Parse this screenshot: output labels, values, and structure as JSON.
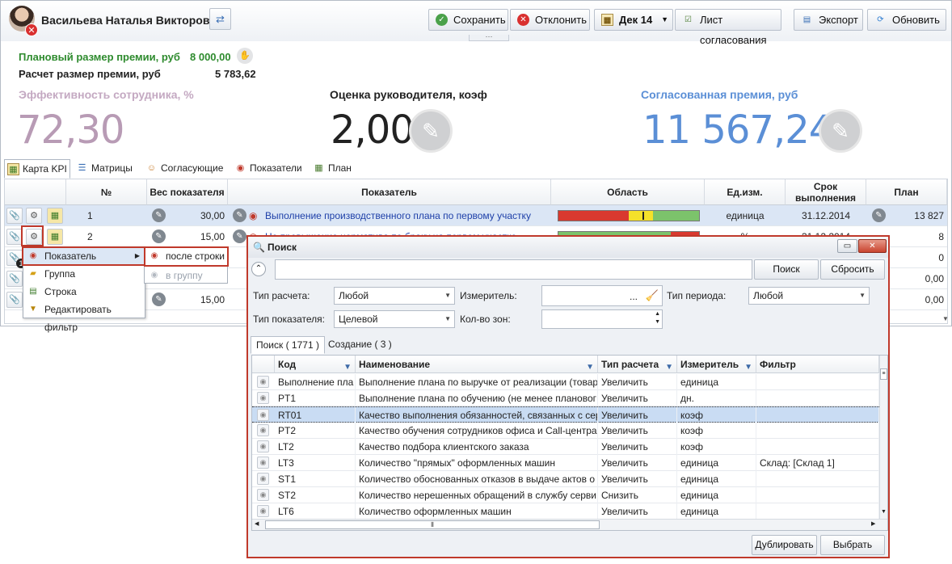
{
  "user": {
    "name": "Васильева Наталья Викторовна"
  },
  "toolbar": {
    "save": "Сохранить",
    "reject": "Отклонить",
    "period": "Дек 14",
    "approval_sheet": "Лист согласования",
    "export": "Экспорт",
    "refresh": "Обновить"
  },
  "summary": {
    "planned_label": "Плановый размер премии, руб",
    "planned_value": "8 000,00",
    "calc_label": "Расчет размер премии, руб",
    "calc_value": "5 783,62"
  },
  "metrics": [
    {
      "label": "Эффективность сотрудника, %",
      "value": "72,30",
      "color": "#b89bb5"
    },
    {
      "label": "Оценка руководителя, коэф",
      "value": "2,00",
      "color": "#222222"
    },
    {
      "label": "Согласованная премия, руб",
      "value": "11 567,24",
      "color": "#5b8fd6"
    }
  ],
  "tabs": [
    "Карта KPI",
    "Матрицы",
    "Согласующие",
    "Показатели",
    "План"
  ],
  "grid": {
    "headers": {
      "num": "№",
      "weight": "Вес показателя",
      "indicator": "Показатель",
      "area": "Область",
      "unit": "Ед.изм.",
      "deadline": "Срок выполнения",
      "plan": "План"
    },
    "rows": [
      {
        "num": "1",
        "weight": "30,00",
        "indicator": "Выполнение производственного плана по первому участку",
        "unit": "единица",
        "deadline": "31.12.2014",
        "plan": "13 827"
      },
      {
        "num": "2",
        "weight": "15,00",
        "indicator": "Не превышение норматива по браку на первом участке",
        "unit": "%",
        "deadline": "31.12.2014",
        "plan": "8"
      },
      {
        "plan": "0"
      },
      {
        "plan": "0,00"
      },
      {
        "weight": "15,00",
        "plan": "0,00"
      }
    ],
    "badge": "1"
  },
  "context_menu": {
    "items": [
      "Показатель",
      "Группа",
      "Строка",
      "Редактировать фильтр"
    ],
    "submenu": [
      "после строки",
      "в группу"
    ]
  },
  "dialog": {
    "title": "Поиск",
    "search_btn": "Поиск",
    "reset_btn": "Сбросить",
    "calc_type_label": "Тип расчета:",
    "calc_type_value": "Любой",
    "meter_label": "Измеритель:",
    "meter_value": "...",
    "period_type_label": "Тип периода:",
    "period_type_value": "Любой",
    "indicator_type_label": "Тип показателя:",
    "indicator_type_value": "Целевой",
    "zones_label": "Кол-во зон:",
    "tab_search": "Поиск ( 1771 )",
    "tab_create": "Создание ( 3 )",
    "columns": [
      "Код",
      "Наименование",
      "Тип расчета",
      "Измеритель",
      "Фильтр"
    ],
    "rows": [
      [
        "Выполнение пла",
        "Выполнение плана по выручке от реализации (товар",
        "Увеличить",
        "единица",
        ""
      ],
      [
        "PT1",
        "Выполнение плана по обучению (не менее плановог",
        "Увеличить",
        "дн.",
        ""
      ],
      [
        "RT01",
        "Качество выполнения обязанностей, связанных с сер",
        "Увеличить",
        "коэф",
        ""
      ],
      [
        "PT2",
        "Качество обучения сотрудников офиса и Call-центра",
        "Увеличить",
        "коэф",
        ""
      ],
      [
        "LT2",
        "Качество подбора клиентского заказа",
        "Увеличить",
        "коэф",
        ""
      ],
      [
        "LT3",
        "Количество \"прямых\" оформленных машин",
        "Увеличить",
        "единица",
        "Склад: [Склад 1]"
      ],
      [
        "ST1",
        "Количество обоснованных отказов в выдаче актов о",
        "Увеличить",
        "единица",
        ""
      ],
      [
        "ST2",
        "Количество нерешенных обращений в службу серви",
        "Снизить",
        "единица",
        ""
      ],
      [
        "LT6",
        "Количество оформленных машин",
        "Увеличить",
        "единица",
        ""
      ]
    ],
    "duplicate_btn": "Дублировать",
    "select_btn": "Выбрать"
  }
}
